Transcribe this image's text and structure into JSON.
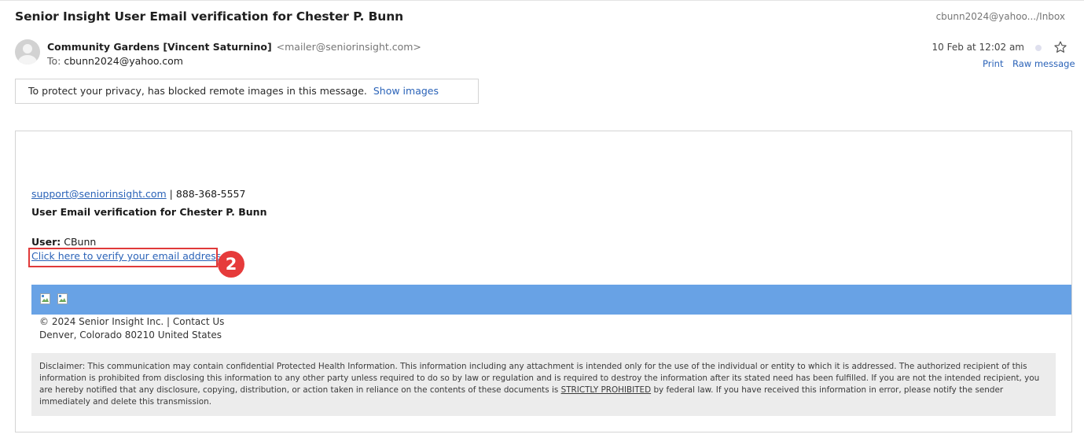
{
  "message": {
    "subject": "Senior Insight User Email verification for Chester P. Bunn",
    "mailbox_path": "cbunn2024@yahoo.../Inbox",
    "sender_name": "Community Gardens [Vincent Saturnino]",
    "sender_email": "<mailer@seniorinsight.com>",
    "to_label": "To:",
    "to_address": "cbunn2024@yahoo.com",
    "date": "10 Feb at 12:02 am",
    "print_label": "Print",
    "raw_label": "Raw message"
  },
  "privacy_notice": {
    "text": "To protect your privacy, has blocked remote images in this message.",
    "show_images_label": "Show images"
  },
  "email_body": {
    "support_email": "support@seniorinsight.com",
    "separator": "|",
    "support_phone": "888-368-5557",
    "heading": "User Email verification for Chester P. Bunn",
    "user_label": "User:",
    "user_value": "CBunn",
    "verify_link": "Click here to verify your email address",
    "step_number": "2",
    "footer_line1": "© 2024 Senior Insight Inc. | Contact Us",
    "footer_line2": "Denver, Colorado 80210 United States",
    "disclaimer_part1": "Disclaimer: This communication may contain confidential Protected Health Information. This information including any attachment is intended only for the use of the individual or entity to which it is addressed. The authorized recipient of this information is prohibited from disclosing this information to any other party unless required to do so by law or regulation and is required to destroy the information after its stated need has been fulfilled. If you are not the intended recipient, you are hereby notified that any disclosure, copying, distribution, or action taken in reliance on the contents of these documents is",
    "disclaimer_emphasis": "STRICTLY PROHIBITED",
    "disclaimer_part2": "by federal law. If you have received this information in error, please notify the sender immediately and delete this transmission."
  },
  "colors": {
    "link": "#2b63b8",
    "banner": "#68a2e5",
    "highlight": "#e03a3a",
    "badge": "#e63b3b"
  },
  "icons": [
    "avatar-icon",
    "star-icon",
    "unread-dot-icon",
    "broken-image-icon"
  ]
}
